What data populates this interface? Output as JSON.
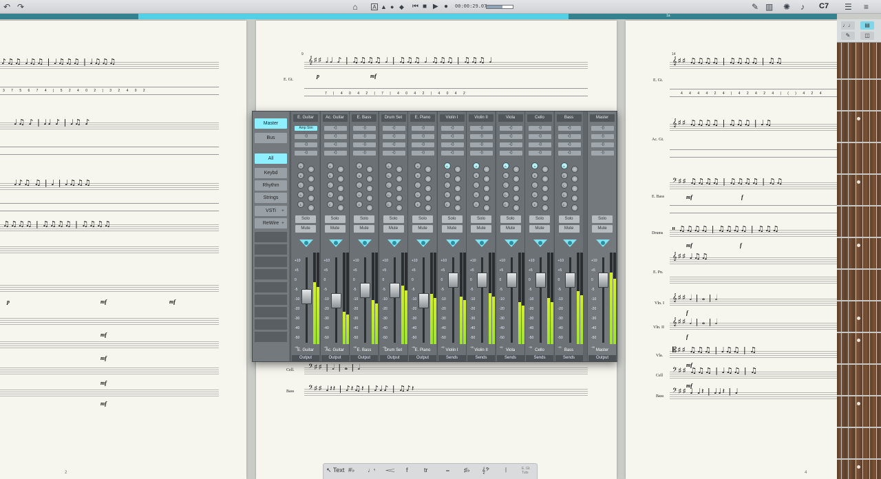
{
  "toolbar": {
    "timecode": "00:00:29.07",
    "chord": "C7",
    "tempo_fill": 0.6
  },
  "timeline": {
    "marks": [
      "1a"
    ]
  },
  "pages": {
    "left_number": "2",
    "middle_number": "9",
    "right_number": "4",
    "right_first_measure": "14"
  },
  "score_middle": {
    "labels": [
      "E. Gt.",
      "Cell.",
      "Bass"
    ]
  },
  "score_right": {
    "labels": [
      "E. Gt.",
      "Ac. Gt.",
      "E. Bass",
      "Drums",
      "E. Pn.",
      "Vln. I",
      "Vln. II",
      "Vla.",
      "Cell",
      "Bass"
    ]
  },
  "dynamics": {
    "mf": "mf",
    "p": "p",
    "f": "f"
  },
  "palette": {
    "text": "Text",
    "accidentals": "#♭",
    "rhythm": "♩𝄾",
    "hairpin": "𝆒",
    "dynamic": "f",
    "trill": "tr",
    "ornament": "𝆗",
    "keysig": "♯♭",
    "clef": "𝄞𝄢",
    "barline": "𝄁",
    "instrument": "E. Gt. Tuts"
  },
  "mixer": {
    "left_buttons": {
      "master": "Master",
      "bus": "Bus",
      "all": "All",
      "keybd": "Keybd",
      "rhythm": "Rhythm",
      "strings": "Strings",
      "vsti": "VSTi",
      "rewire": "ReWire"
    },
    "solo_label": "Solo",
    "mute_label": "Mute",
    "scale": [
      "+10",
      "+5",
      "0",
      "-5",
      "-10",
      "-20",
      "-30",
      "-40",
      "-50",
      "-∞"
    ],
    "knob_letters": [
      "A",
      "B",
      "C",
      "D",
      "E"
    ],
    "channels": [
      {
        "name": "E. Guitar",
        "out": "Output",
        "fx": "Amp Sim",
        "fader": -8,
        "meter": 0.68
      },
      {
        "name": "Ac. Guitar",
        "out": "Output",
        "fx": "",
        "fader": -10,
        "meter": 0.35
      },
      {
        "name": "E. Bass",
        "out": "Output",
        "fx": "",
        "fader": -5,
        "meter": 0.48
      },
      {
        "name": "Drum Set",
        "out": "Output",
        "fx": "",
        "fader": -5,
        "meter": 0.64
      },
      {
        "name": "E. Piano",
        "out": "Output",
        "fx": "",
        "fader": -10,
        "meter": 0.55
      },
      {
        "name": "Violin I",
        "out": "Sends",
        "fx": "",
        "fader": 0,
        "meter": 0.52
      },
      {
        "name": "Violin II",
        "out": "Sends",
        "fx": "",
        "fader": 0,
        "meter": 0.56
      },
      {
        "name": "Viola",
        "out": "Sends",
        "fx": "",
        "fader": 0,
        "meter": 0.46
      },
      {
        "name": "Cello",
        "out": "Sends",
        "fx": "",
        "fader": 0,
        "meter": 0.5
      },
      {
        "name": "Bass",
        "out": "Sends",
        "fx": "",
        "fader": 0,
        "meter": 0.58
      }
    ],
    "master": {
      "name": "Master",
      "out": "Output",
      "fader": 0,
      "meter": 0.78
    }
  }
}
